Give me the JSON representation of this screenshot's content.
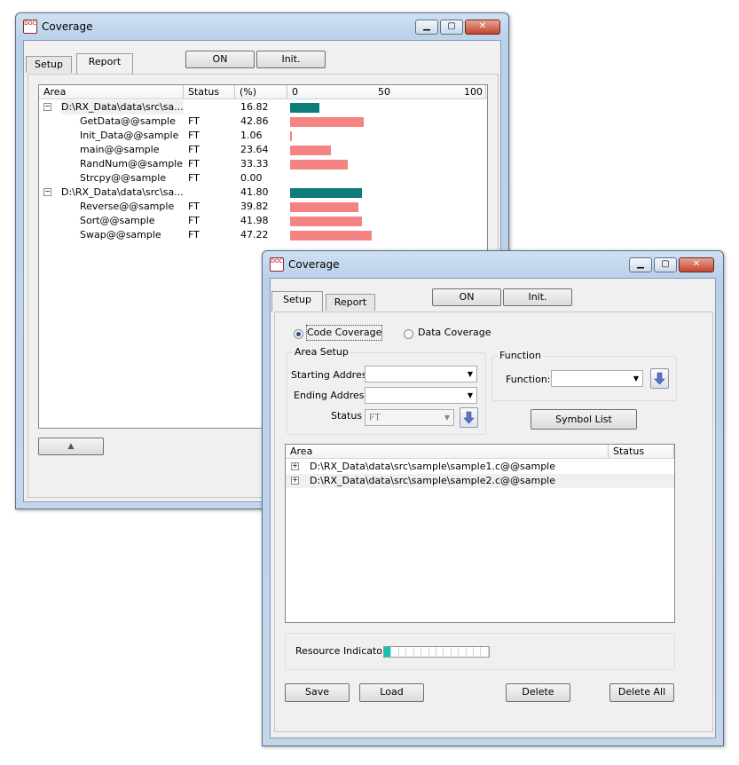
{
  "report_window": {
    "title": "Coverage",
    "tabs": [
      {
        "label": "Setup"
      },
      {
        "label": "Report"
      }
    ],
    "buttons": {
      "on": "ON",
      "init": "Init."
    },
    "columns": {
      "area": "Area",
      "status": "Status",
      "pct": "(%)",
      "scale0": "0",
      "scale50": "50",
      "scale100": "100"
    },
    "rows": [
      {
        "expander": "−",
        "area": "D:\\RX_Data\\data\\src\\sa...",
        "status": "",
        "pct": "16.82",
        "value": 16.82,
        "kind": "file"
      },
      {
        "area": "GetData@@sample",
        "status": "FT",
        "pct": "42.86",
        "value": 42.86,
        "kind": "func"
      },
      {
        "area": "Init_Data@@sample",
        "status": "FT",
        "pct": "1.06",
        "value": 1.06,
        "kind": "func"
      },
      {
        "area": "main@@sample",
        "status": "FT",
        "pct": "23.64",
        "value": 23.64,
        "kind": "func"
      },
      {
        "area": "RandNum@@sample",
        "status": "FT",
        "pct": "33.33",
        "value": 33.33,
        "kind": "func"
      },
      {
        "area": "Strcpy@@sample",
        "status": "FT",
        "pct": "0.00",
        "value": 0,
        "kind": "func"
      },
      {
        "expander": "−",
        "area": "D:\\RX_Data\\data\\src\\sa...",
        "status": "",
        "pct": "41.80",
        "value": 41.8,
        "kind": "file"
      },
      {
        "area": "Reverse@@sample",
        "status": "FT",
        "pct": "39.82",
        "value": 39.82,
        "kind": "func"
      },
      {
        "area": "Sort@@sample",
        "status": "FT",
        "pct": "41.98",
        "value": 41.98,
        "kind": "func"
      },
      {
        "area": "Swap@@sample",
        "status": "FT",
        "pct": "47.22",
        "value": 47.22,
        "kind": "func"
      }
    ],
    "up_button": "▲",
    "colors": {
      "file_bar": "#0c7d78",
      "func_bar": "#f48484"
    }
  },
  "setup_window": {
    "title": "Coverage",
    "tabs": [
      {
        "label": "Setup"
      },
      {
        "label": "Report"
      }
    ],
    "buttons": {
      "on": "ON",
      "init": "Init."
    },
    "radio_code": "Code Coverage",
    "radio_data": "Data Coverage",
    "area_setup": {
      "label": "Area Setup",
      "starting_address": "Starting Address",
      "ending_address": "Ending Address",
      "status_label": "Status",
      "status_value": "FT"
    },
    "function_group": {
      "label": "Function",
      "field_label": "Function:"
    },
    "symbol_list": "Symbol List",
    "list": {
      "columns": {
        "area": "Area",
        "status": "Status"
      },
      "rows": [
        {
          "expander": "+",
          "area": "D:\\RX_Data\\data\\src\\sample\\sample1.c@@sample"
        },
        {
          "expander": "+",
          "area": "D:\\RX_Data\\data\\src\\sample\\sample2.c@@sample"
        }
      ]
    },
    "resource_indicator": {
      "label": "Resource Indicator",
      "filled": 1,
      "total": 14
    },
    "footer": {
      "save": "Save",
      "load": "Load",
      "delete": "Delete",
      "delete_all": "Delete All"
    }
  }
}
